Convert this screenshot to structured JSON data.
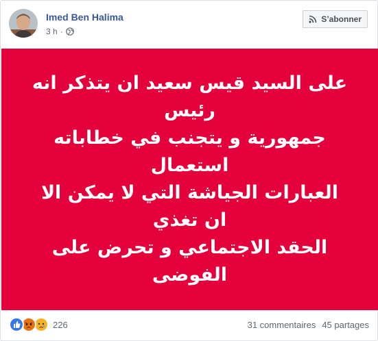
{
  "post": {
    "author": "Imed Ben Halima",
    "time": "3 h",
    "separator": "·",
    "privacy_icon": "globe-icon",
    "follow_label": "S’abonner",
    "follow_icon": "rss-icon",
    "text_lines": [
      "على السيد قيس سعيد ان يتذكر انه رئيس",
      "جمهورية و يتجنب في خطاباته استعمال",
      "العبارات الجياشة التي لا يمكن الا ان تغذي",
      "الحقد الاجتماعي و تحرض على الفوضى"
    ],
    "banner_color": "#e4003b"
  },
  "footer": {
    "reaction_icons": [
      "like-icon",
      "angry-icon",
      "sad-icon"
    ],
    "reaction_count": "226",
    "comments": "31 commentaires",
    "shares": "45 partages"
  },
  "colors": {
    "author_link": "#385898",
    "meta": "#616770",
    "card_border": "#dddfe2"
  }
}
